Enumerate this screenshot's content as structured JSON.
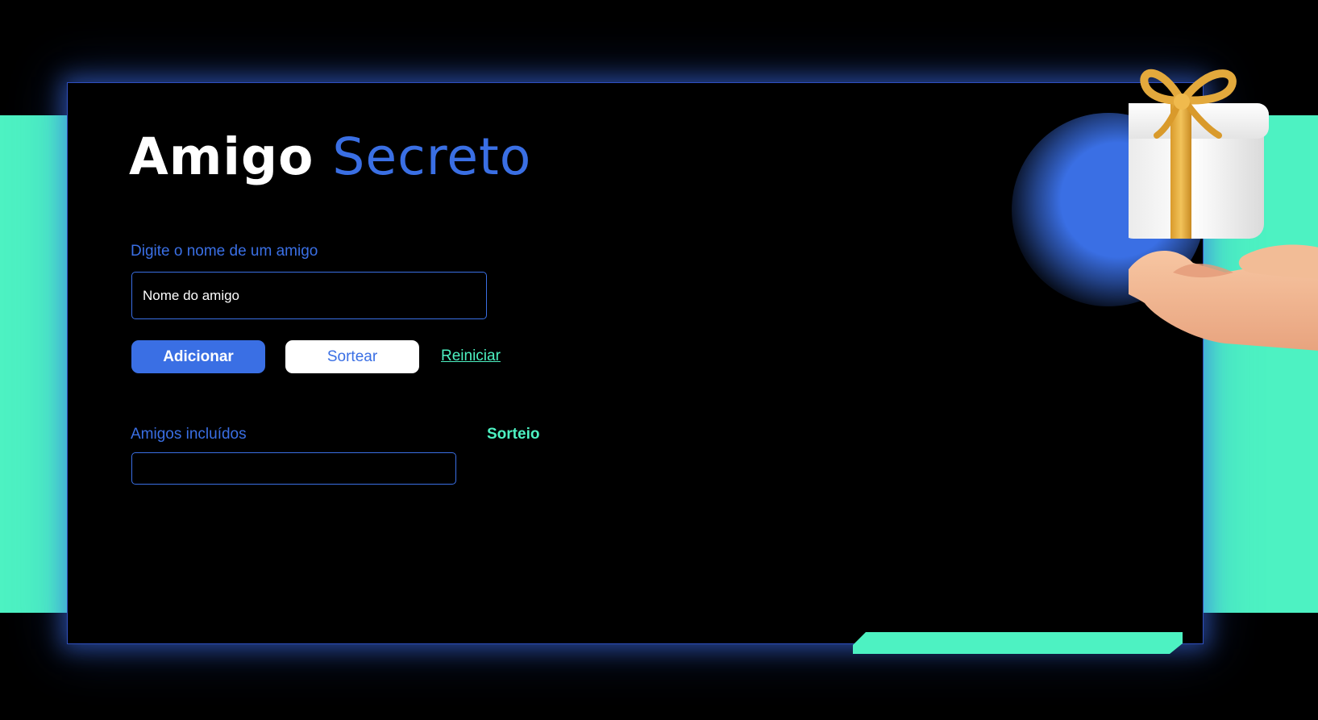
{
  "header": {
    "title_part1": "Amigo",
    "title_part2": "Secreto"
  },
  "form": {
    "input_label": "Digite o nome de um amigo",
    "input_placeholder": "Nome do amigo",
    "input_value": ""
  },
  "actions": {
    "add_label": "Adicionar",
    "draw_label": "Sortear",
    "reset_label": "Reiniciar"
  },
  "friends": {
    "heading": "Amigos incluídos",
    "items": []
  },
  "result": {
    "heading": "Sorteio",
    "value": ""
  },
  "theme": {
    "accent_blue": "#3A6FE4",
    "accent_mint": "#4DF2C2",
    "background": "#000000",
    "text_white": "#FFFFFF"
  },
  "illustration": {
    "icon": "gift-on-hand-icon"
  }
}
